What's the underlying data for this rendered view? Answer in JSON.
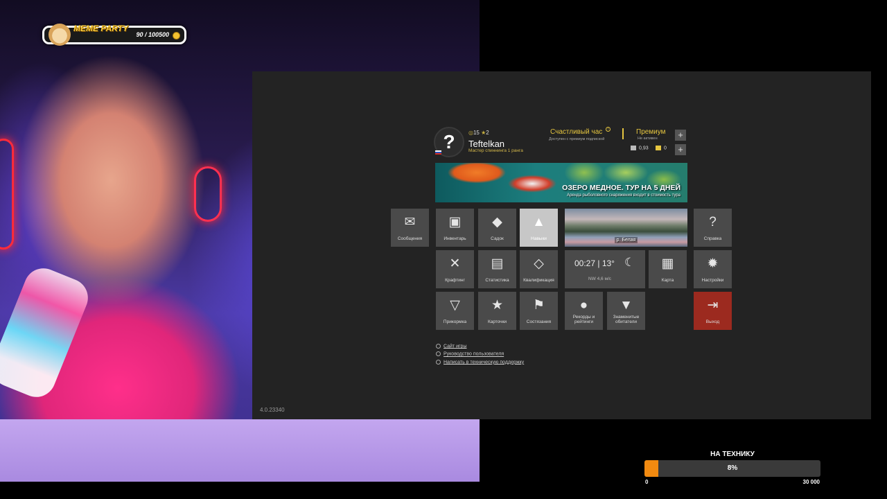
{
  "overlay": {
    "meme_party": {
      "title": "MEME PARTY",
      "progress": "90 / 100500"
    },
    "donation_goal": {
      "title": "НА ТЕХНИКУ",
      "percent_label": "8%",
      "fill_fraction": 0.08,
      "min_label": "0",
      "max_label": "30 000"
    }
  },
  "game": {
    "version": "4.0.23340",
    "profile": {
      "avatar": "?",
      "level": "15",
      "stars": "2",
      "name": "Teftelkan",
      "rank": "Мастер спиннинга 1 ранга"
    },
    "happy_hour": {
      "title": "Счастливый час",
      "subtitle": "Доступен с премиум подпиской"
    },
    "premium": {
      "title": "Премиум",
      "subtitle": "Не активен"
    },
    "currency": {
      "silver": "0,93",
      "gold": "0"
    },
    "banner": {
      "title": "ОЗЕРО МЕДНОЕ. ТУР НА 5 ДНЕЙ",
      "subtitle": "Аренда рыболовного снаряжения входит в стоимость тура"
    },
    "tiles": {
      "messages": "Сообщения",
      "inventory": "Инвентарь",
      "keepnet": "Садок",
      "skills": "Навыки",
      "help": "Справка",
      "crafting": "Крафтинг",
      "stats": "Статистика",
      "qualification": "Квалификация",
      "map": "Карта",
      "settings": "Настройки",
      "bait": "Прикормка",
      "cards": "Карточки",
      "competitions": "Состязания",
      "records": "Рекорды и рейтинги",
      "famous": "Знаменитые обитатели",
      "exit": "Выход"
    },
    "location": "р. Белая",
    "weather": {
      "time": "00:27 | 13°",
      "wind": "NW 4,6 м/с"
    },
    "links": [
      "Сайт игры",
      "Руководство пользователя",
      "Написать в техническую поддержку"
    ],
    "colors": {
      "accent": "#e6c640",
      "exit": "#9c2a1f",
      "goal_fill": "#f28a10"
    }
  }
}
